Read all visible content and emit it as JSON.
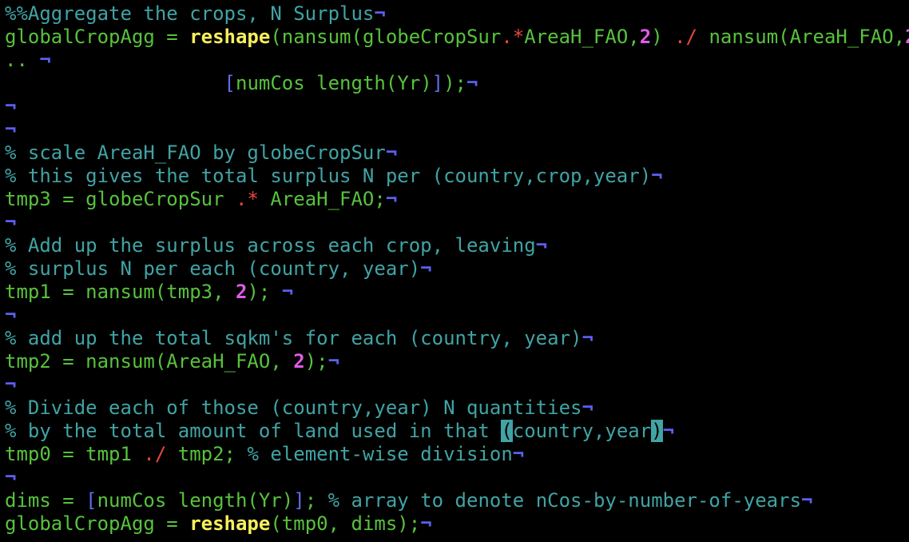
{
  "editor": {
    "lines": [
      [
        {
          "t": "%%Aggregate the crops, N Surplus",
          "c": "cm"
        },
        {
          "t": "¬",
          "c": "nl"
        }
      ],
      [
        {
          "t": "globalCropAgg = ",
          "c": "id"
        },
        {
          "t": "reshape",
          "c": "fn"
        },
        {
          "t": "(nansum(globeCropSur",
          "c": "id"
        },
        {
          "t": ".*",
          "c": "op"
        },
        {
          "t": "AreaH_FAO,",
          "c": "id"
        },
        {
          "t": "2",
          "c": "num"
        },
        {
          "t": ") ",
          "c": "id"
        },
        {
          "t": "./",
          "c": "op"
        },
        {
          "t": " nansum(AreaH_FAO,",
          "c": "id"
        },
        {
          "t": "2",
          "c": "num"
        },
        {
          "t": "),.",
          "c": "id"
        }
      ],
      [
        {
          "t": ".. ",
          "c": "id"
        },
        {
          "t": "¬",
          "c": "nl"
        }
      ],
      [
        {
          "t": "                   ",
          "c": "id"
        },
        {
          "t": "[",
          "c": "br"
        },
        {
          "t": "numCos length(Yr)",
          "c": "id"
        },
        {
          "t": "]",
          "c": "br"
        },
        {
          "t": ");",
          "c": "id"
        },
        {
          "t": "¬",
          "c": "nl"
        }
      ],
      [
        {
          "t": "¬",
          "c": "nl"
        }
      ],
      [
        {
          "t": "¬",
          "c": "nl"
        }
      ],
      [
        {
          "t": "% scale AreaH_FAO by globeCropSur",
          "c": "cm"
        },
        {
          "t": "¬",
          "c": "nl"
        }
      ],
      [
        {
          "t": "% this gives the total surplus N per (country,crop,year)",
          "c": "cm"
        },
        {
          "t": "¬",
          "c": "nl"
        }
      ],
      [
        {
          "t": "tmp3 = globeCropSur ",
          "c": "id"
        },
        {
          "t": ".*",
          "c": "op"
        },
        {
          "t": " AreaH_FAO;",
          "c": "id"
        },
        {
          "t": "¬",
          "c": "nl"
        }
      ],
      [
        {
          "t": "¬",
          "c": "nl"
        }
      ],
      [
        {
          "t": "% Add up the surplus across each crop, leaving",
          "c": "cm"
        },
        {
          "t": "¬",
          "c": "nl"
        }
      ],
      [
        {
          "t": "% surplus N per each (country, year)",
          "c": "cm"
        },
        {
          "t": "¬",
          "c": "nl"
        }
      ],
      [
        {
          "t": "tmp1 = nansum(tmp3, ",
          "c": "id"
        },
        {
          "t": "2",
          "c": "num"
        },
        {
          "t": "); ",
          "c": "id"
        },
        {
          "t": "¬",
          "c": "nl"
        }
      ],
      [
        {
          "t": "¬",
          "c": "nl"
        }
      ],
      [
        {
          "t": "% add up the total sqkm's for each (country, year)",
          "c": "cm"
        },
        {
          "t": "¬",
          "c": "nl"
        }
      ],
      [
        {
          "t": "tmp2 = nansum(AreaH_FAO, ",
          "c": "id"
        },
        {
          "t": "2",
          "c": "num"
        },
        {
          "t": ");",
          "c": "id"
        },
        {
          "t": "¬",
          "c": "nl"
        }
      ],
      [
        {
          "t": "¬",
          "c": "nl"
        }
      ],
      [
        {
          "t": "% Divide each of those (country,year) N quantities",
          "c": "cm"
        },
        {
          "t": "¬",
          "c": "nl"
        }
      ],
      [
        {
          "t": "% by the total amount of land used in that ",
          "c": "cm"
        },
        {
          "t": "(",
          "c": "hl"
        },
        {
          "t": "country,year",
          "c": "cm"
        },
        {
          "t": ")",
          "c": "hl"
        },
        {
          "t": "¬",
          "c": "nl"
        }
      ],
      [
        {
          "t": "tmp0 = tmp1 ",
          "c": "id"
        },
        {
          "t": "./",
          "c": "op"
        },
        {
          "t": " tmp2; ",
          "c": "id"
        },
        {
          "t": "% element-wise division",
          "c": "cm"
        },
        {
          "t": "¬",
          "c": "nl"
        }
      ],
      [
        {
          "t": "¬",
          "c": "nl"
        }
      ],
      [
        {
          "t": "dims = ",
          "c": "id"
        },
        {
          "t": "[",
          "c": "br"
        },
        {
          "t": "numCos length(Yr)",
          "c": "id"
        },
        {
          "t": "]",
          "c": "br"
        },
        {
          "t": "; ",
          "c": "id"
        },
        {
          "t": "% array to denote nCos-by-number-of-years",
          "c": "cm"
        },
        {
          "t": "¬",
          "c": "nl"
        }
      ],
      [
        {
          "t": "globalCropAgg = ",
          "c": "id"
        },
        {
          "t": "reshape",
          "c": "fn"
        },
        {
          "t": "(tmp0, dims);",
          "c": "id"
        },
        {
          "t": "¬",
          "c": "nl"
        }
      ]
    ]
  },
  "colors": {
    "background": "#000000",
    "comment": "#41a3a4",
    "identifier": "#58c23c",
    "function": "#f7ef5b",
    "operator": "#e8473f",
    "number": "#e15be8",
    "bracket": "#5d6ee6",
    "newline_marker": "#5d5ff0",
    "cursor_highlight": "#41a3a4"
  }
}
